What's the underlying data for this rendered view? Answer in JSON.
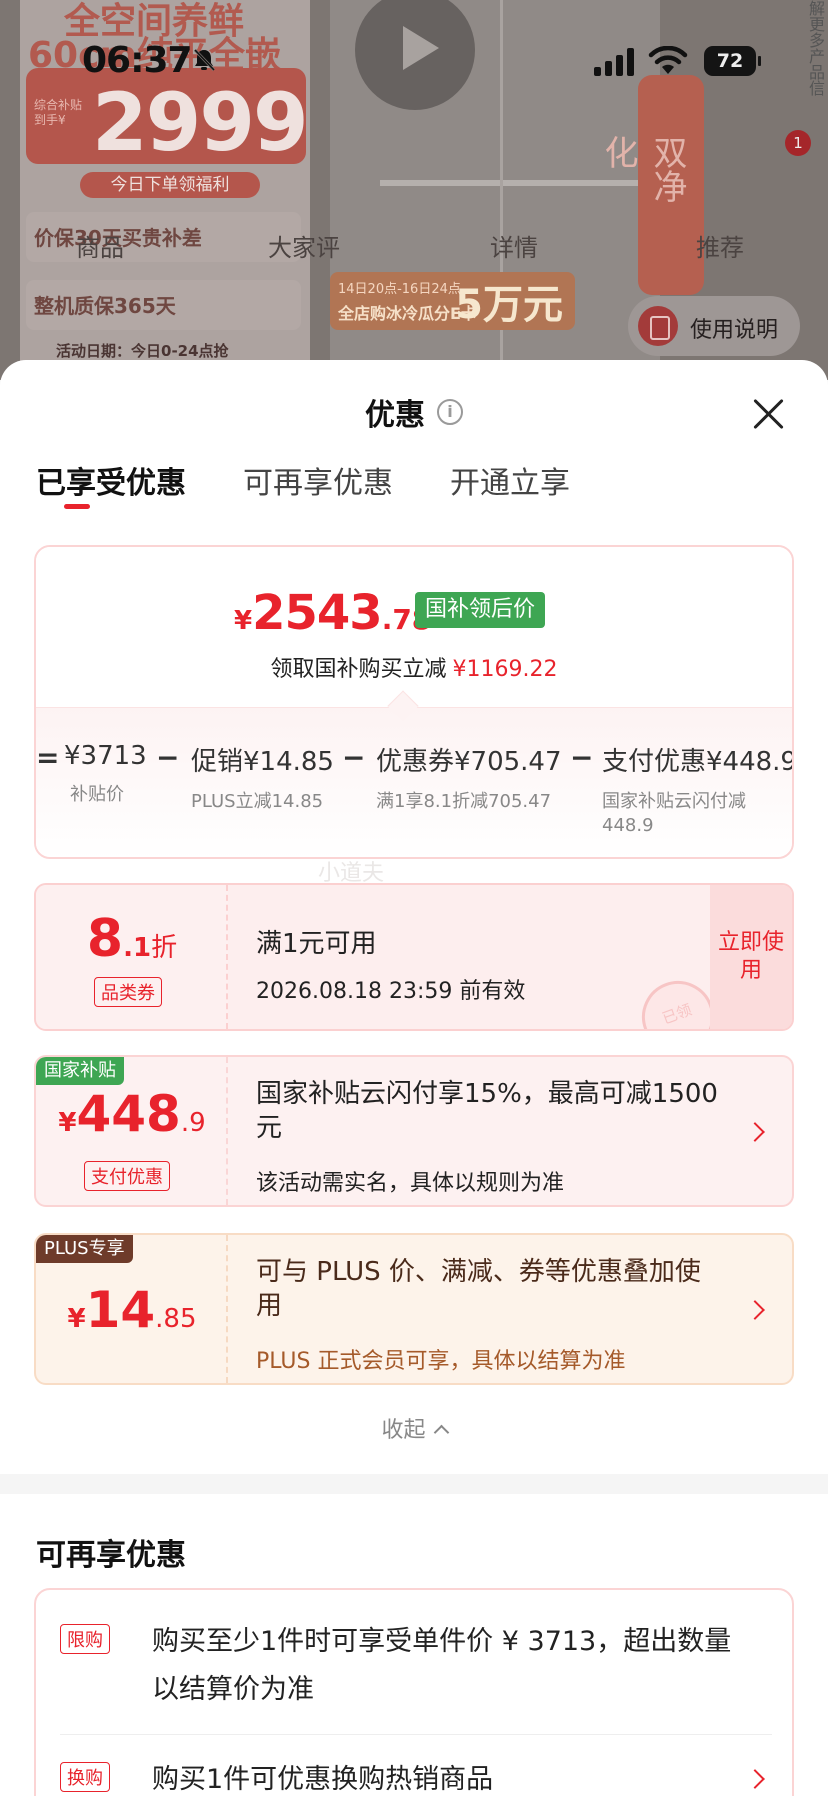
{
  "background": {
    "poster": {
      "line1": "全空间养鲜",
      "line2": "60cm纯平全嵌",
      "subsidy_label": "综合补贴 到手¥",
      "price": "2999",
      "tag": "今日下单领福利",
      "row1": "价保30天买贵补差",
      "row2": "整机质保365天",
      "date": "活动日期：今日0-24点抢"
    },
    "banner": {
      "line1": "14日20点-16日24点",
      "line2": "全店购冰冷瓜分E卡",
      "big": "5万元"
    },
    "pill_text": "双净化",
    "side_text": "解更多产品信",
    "badge_count": "1",
    "tabs": [
      "商品",
      "大家评",
      "详情",
      "推荐"
    ],
    "help_label": "使用说明"
  },
  "status_bar": {
    "time": "06:37",
    "battery": "72"
  },
  "sheet": {
    "title": "优惠",
    "tabs": [
      "已享受优惠",
      "可再享优惠",
      "开通立享"
    ],
    "summary": {
      "currency": "¥",
      "final_price_int": "2543",
      "final_price_dec": ".78",
      "badge": "国补领后价",
      "reduce_text": "领取国补购买立减",
      "reduce_amount": "¥1169.22",
      "formula": [
        {
          "main": "¥3713",
          "sub": "补贴价"
        },
        {
          "main": "促销¥14.85",
          "sub": "PLUS立减14.85"
        },
        {
          "main": "优惠券¥705.47",
          "sub": "满1享8.1折减705.47"
        },
        {
          "main": "支付优惠¥448.9",
          "sub": "国家补贴云闪付减 448.9"
        }
      ]
    },
    "watermark": "小道夫",
    "coupons": [
      {
        "discount_int": "8",
        "discount_dec": ".1",
        "discount_unit": "折",
        "type_tag": "品类券",
        "line1": "满1元可用",
        "line2": "2026.08.18 23:59 前有效",
        "button": "立即使用",
        "stamp": "已领"
      },
      {
        "corner": "国家补贴",
        "currency": "¥",
        "amount_int": "448",
        "amount_dec": ".9",
        "type_tag": "支付优惠",
        "line1": "国家补贴云闪付享15%，最高可减1500元",
        "line2": "该活动需实名，具体以规则为准"
      },
      {
        "corner": "PLUS专享",
        "currency": "¥",
        "amount_int": "14",
        "amount_dec": ".85",
        "line1": "可与 PLUS 价、满减、券等优惠叠加使用",
        "line2": "PLUS 正式会员可享，具体以结算为准"
      }
    ],
    "collapse": "收起",
    "more_title": "可再享优惠",
    "more": [
      {
        "tag": "限购",
        "text": "购买至少1件时可享受单件价 ¥ 3713，超出数量以结算价为准"
      },
      {
        "tag": "换购",
        "text": "购买1件可优惠换购热销商品"
      }
    ]
  },
  "colors": {
    "accent_red": "#e8232c",
    "gov_green": "#3ea653",
    "plus_brown": "#6e3b2a"
  }
}
